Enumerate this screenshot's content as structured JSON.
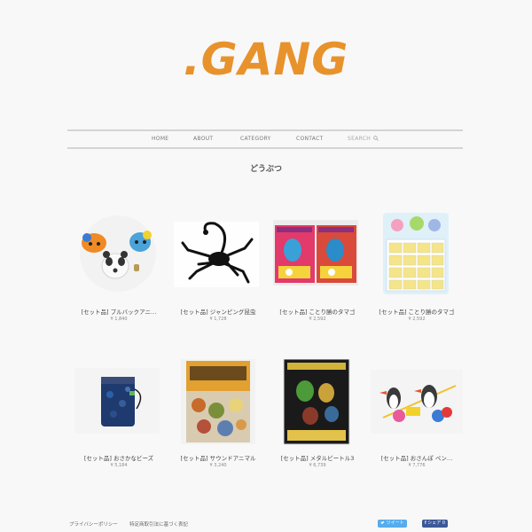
{
  "logo": ".GANG",
  "nav": {
    "home": "HOME",
    "about": "ABOUT",
    "category": "CATEGORY",
    "contact": "CONTACT",
    "search": "SEARCH"
  },
  "page_title": "どうぶつ",
  "products": [
    {
      "name": "[セット品] プルバックアニ…",
      "price": "¥ 1,840"
    },
    {
      "name": "[セット品] ジャンピング昆虫",
      "price": "¥ 1,728"
    },
    {
      "name": "[セット品] ことり勝のタマゴ",
      "price": "¥ 2,592"
    },
    {
      "name": "[セット品] ことり勝のタマゴ",
      "price": "¥ 2,592"
    },
    {
      "name": "[セット品] おさかなビーズ",
      "price": "¥ 5,184"
    },
    {
      "name": "[セット品] サウンドアニマル",
      "price": "¥ 3,240"
    },
    {
      "name": "[セット品] メタルビートル3",
      "price": "¥ 6,739"
    },
    {
      "name": "[セット品] おさんぽ ペン…",
      "price": "¥ 7,776"
    }
  ],
  "footer": {
    "privacy": "プライバシーポリシー",
    "law": "特定商取引法に基づく表記",
    "tweet": "ツイート",
    "share": "シェア 0"
  },
  "colors": {
    "logo": "#e8922c",
    "tweet": "#55acee",
    "facebook": "#3b5998"
  }
}
